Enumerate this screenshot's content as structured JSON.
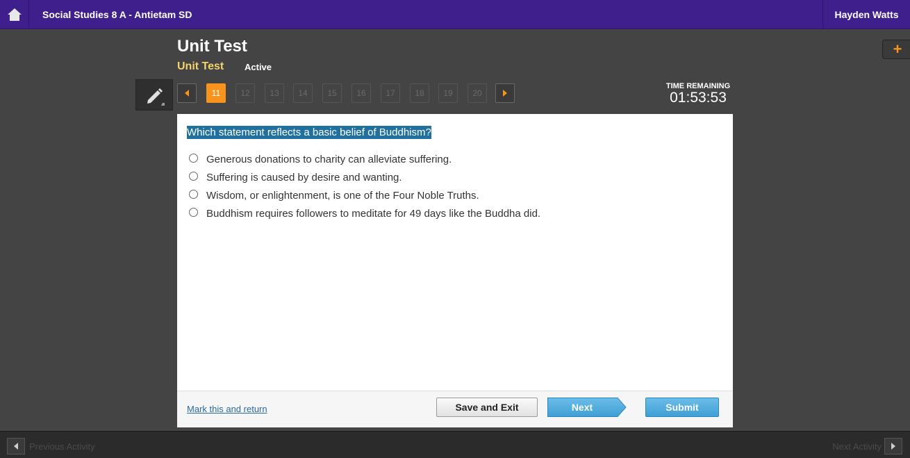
{
  "topbar": {
    "home_icon": "home-icon",
    "course_title": "Social Studies 8 A - Antietam SD",
    "user_name": "Hayden Watts"
  },
  "header": {
    "title": "Unit Test",
    "subtitle": "Unit Test",
    "status": "Active",
    "plus_icon": "plus-icon",
    "plus_glyph": "+"
  },
  "toolbar": {
    "pencil_icon": "pencil-icon",
    "prev_icon": "caret-left-icon",
    "next_icon": "caret-right-icon",
    "questions": [
      {
        "label": "11",
        "active": true
      },
      {
        "label": "12",
        "active": false
      },
      {
        "label": "13",
        "active": false
      },
      {
        "label": "14",
        "active": false
      },
      {
        "label": "15",
        "active": false
      },
      {
        "label": "16",
        "active": false
      },
      {
        "label": "17",
        "active": false
      },
      {
        "label": "18",
        "active": false
      },
      {
        "label": "19",
        "active": false
      },
      {
        "label": "20",
        "active": false
      }
    ],
    "accent_color": "#f7941d"
  },
  "timer": {
    "label": "TIME REMAINING",
    "value": "01:53:53"
  },
  "question": {
    "text": "Which statement reflects a basic belief of Buddhism?",
    "highlight_color": "#2070a0",
    "options": [
      "Generous donations to charity can alleviate suffering.",
      "Suffering is caused by desire and wanting.",
      "Wisdom, or enlightenment, is one of the Four Noble Truths.",
      "Buddhism requires followers to meditate for 49 days like the Buddha did."
    ]
  },
  "footer": {
    "mark_link": "Mark this and return",
    "save_label": "Save and Exit",
    "next_label": "Next",
    "submit_label": "Submit"
  },
  "bottombar": {
    "prev_activity": "Previous Activity",
    "next_activity": "Next Activity"
  }
}
